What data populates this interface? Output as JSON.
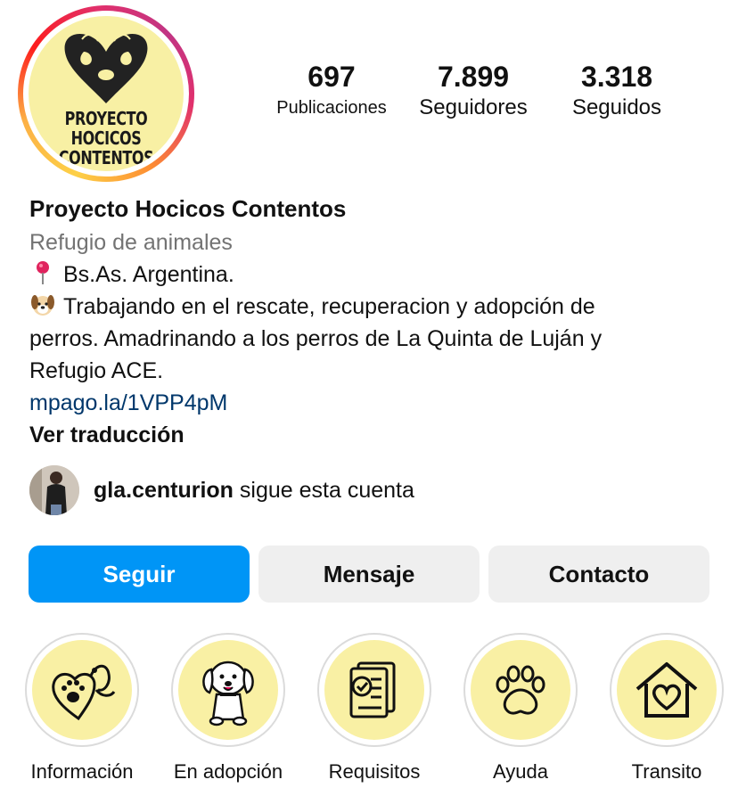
{
  "profile": {
    "logo_lines": [
      "PROYECTO",
      "HOCICOS",
      "CONTENTOS"
    ],
    "stats": [
      {
        "value": "697",
        "label": "Publicaciones"
      },
      {
        "value": "7.899",
        "label": "Seguidores"
      },
      {
        "value": "3.318",
        "label": "Seguidos"
      }
    ]
  },
  "bio": {
    "name": "Proyecto Hocicos Contentos",
    "category": "Refugio de animales",
    "location": "Bs.As. Argentina.",
    "desc_line1": "Trabajando en el rescate, recuperacion y adopción de",
    "desc_line2": "perros. Amadrinando a los perros de La Quinta de Luján y",
    "desc_line3": "Refugio ACE.",
    "link": "mpago.la/1VPP4pM",
    "translate": "Ver traducción"
  },
  "followed_by": {
    "username": "gla.centurion",
    "suffix": " sigue esta cuenta"
  },
  "buttons": {
    "follow": "Seguir",
    "message": "Mensaje",
    "contact": "Contacto"
  },
  "highlights": [
    {
      "label": "Información",
      "icon": "paw-heart-icon"
    },
    {
      "label": "En adopción",
      "icon": "puppy-icon"
    },
    {
      "label": "Requisitos",
      "icon": "checklist-icon"
    },
    {
      "label": "Ayuda",
      "icon": "paw-icon"
    },
    {
      "label": "Transito",
      "icon": "house-heart-icon"
    }
  ],
  "colors": {
    "primary_button": "#0095f6",
    "link": "#00376b",
    "highlight_fill": "#f9f0a4"
  }
}
